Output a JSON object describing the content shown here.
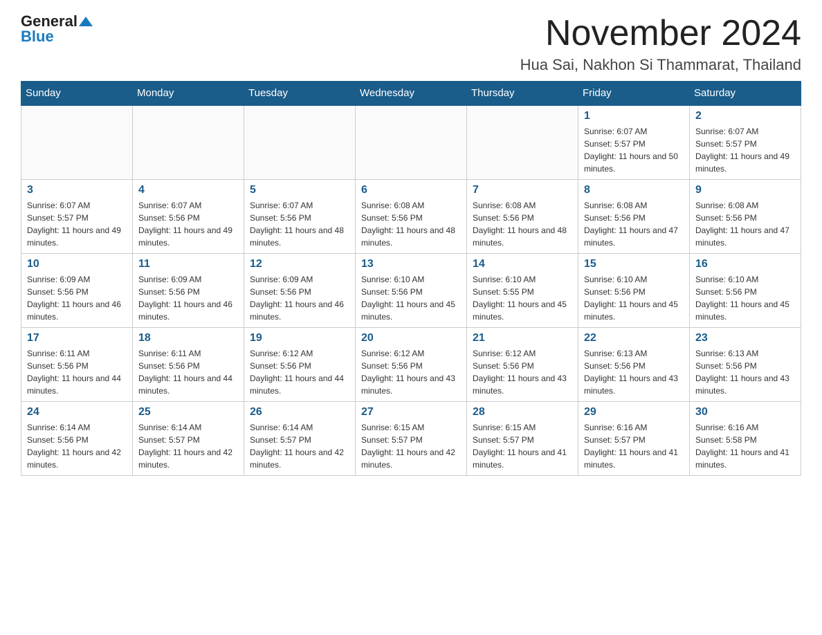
{
  "header": {
    "logo_general": "General",
    "logo_blue": "Blue",
    "month_title": "November 2024",
    "location": "Hua Sai, Nakhon Si Thammarat, Thailand"
  },
  "weekdays": [
    "Sunday",
    "Monday",
    "Tuesday",
    "Wednesday",
    "Thursday",
    "Friday",
    "Saturday"
  ],
  "weeks": [
    [
      {
        "day": "",
        "sunrise": "",
        "sunset": "",
        "daylight": ""
      },
      {
        "day": "",
        "sunrise": "",
        "sunset": "",
        "daylight": ""
      },
      {
        "day": "",
        "sunrise": "",
        "sunset": "",
        "daylight": ""
      },
      {
        "day": "",
        "sunrise": "",
        "sunset": "",
        "daylight": ""
      },
      {
        "day": "",
        "sunrise": "",
        "sunset": "",
        "daylight": ""
      },
      {
        "day": "1",
        "sunrise": "Sunrise: 6:07 AM",
        "sunset": "Sunset: 5:57 PM",
        "daylight": "Daylight: 11 hours and 50 minutes."
      },
      {
        "day": "2",
        "sunrise": "Sunrise: 6:07 AM",
        "sunset": "Sunset: 5:57 PM",
        "daylight": "Daylight: 11 hours and 49 minutes."
      }
    ],
    [
      {
        "day": "3",
        "sunrise": "Sunrise: 6:07 AM",
        "sunset": "Sunset: 5:57 PM",
        "daylight": "Daylight: 11 hours and 49 minutes."
      },
      {
        "day": "4",
        "sunrise": "Sunrise: 6:07 AM",
        "sunset": "Sunset: 5:56 PM",
        "daylight": "Daylight: 11 hours and 49 minutes."
      },
      {
        "day": "5",
        "sunrise": "Sunrise: 6:07 AM",
        "sunset": "Sunset: 5:56 PM",
        "daylight": "Daylight: 11 hours and 48 minutes."
      },
      {
        "day": "6",
        "sunrise": "Sunrise: 6:08 AM",
        "sunset": "Sunset: 5:56 PM",
        "daylight": "Daylight: 11 hours and 48 minutes."
      },
      {
        "day": "7",
        "sunrise": "Sunrise: 6:08 AM",
        "sunset": "Sunset: 5:56 PM",
        "daylight": "Daylight: 11 hours and 48 minutes."
      },
      {
        "day": "8",
        "sunrise": "Sunrise: 6:08 AM",
        "sunset": "Sunset: 5:56 PM",
        "daylight": "Daylight: 11 hours and 47 minutes."
      },
      {
        "day": "9",
        "sunrise": "Sunrise: 6:08 AM",
        "sunset": "Sunset: 5:56 PM",
        "daylight": "Daylight: 11 hours and 47 minutes."
      }
    ],
    [
      {
        "day": "10",
        "sunrise": "Sunrise: 6:09 AM",
        "sunset": "Sunset: 5:56 PM",
        "daylight": "Daylight: 11 hours and 46 minutes."
      },
      {
        "day": "11",
        "sunrise": "Sunrise: 6:09 AM",
        "sunset": "Sunset: 5:56 PM",
        "daylight": "Daylight: 11 hours and 46 minutes."
      },
      {
        "day": "12",
        "sunrise": "Sunrise: 6:09 AM",
        "sunset": "Sunset: 5:56 PM",
        "daylight": "Daylight: 11 hours and 46 minutes."
      },
      {
        "day": "13",
        "sunrise": "Sunrise: 6:10 AM",
        "sunset": "Sunset: 5:56 PM",
        "daylight": "Daylight: 11 hours and 45 minutes."
      },
      {
        "day": "14",
        "sunrise": "Sunrise: 6:10 AM",
        "sunset": "Sunset: 5:55 PM",
        "daylight": "Daylight: 11 hours and 45 minutes."
      },
      {
        "day": "15",
        "sunrise": "Sunrise: 6:10 AM",
        "sunset": "Sunset: 5:56 PM",
        "daylight": "Daylight: 11 hours and 45 minutes."
      },
      {
        "day": "16",
        "sunrise": "Sunrise: 6:10 AM",
        "sunset": "Sunset: 5:56 PM",
        "daylight": "Daylight: 11 hours and 45 minutes."
      }
    ],
    [
      {
        "day": "17",
        "sunrise": "Sunrise: 6:11 AM",
        "sunset": "Sunset: 5:56 PM",
        "daylight": "Daylight: 11 hours and 44 minutes."
      },
      {
        "day": "18",
        "sunrise": "Sunrise: 6:11 AM",
        "sunset": "Sunset: 5:56 PM",
        "daylight": "Daylight: 11 hours and 44 minutes."
      },
      {
        "day": "19",
        "sunrise": "Sunrise: 6:12 AM",
        "sunset": "Sunset: 5:56 PM",
        "daylight": "Daylight: 11 hours and 44 minutes."
      },
      {
        "day": "20",
        "sunrise": "Sunrise: 6:12 AM",
        "sunset": "Sunset: 5:56 PM",
        "daylight": "Daylight: 11 hours and 43 minutes."
      },
      {
        "day": "21",
        "sunrise": "Sunrise: 6:12 AM",
        "sunset": "Sunset: 5:56 PM",
        "daylight": "Daylight: 11 hours and 43 minutes."
      },
      {
        "day": "22",
        "sunrise": "Sunrise: 6:13 AM",
        "sunset": "Sunset: 5:56 PM",
        "daylight": "Daylight: 11 hours and 43 minutes."
      },
      {
        "day": "23",
        "sunrise": "Sunrise: 6:13 AM",
        "sunset": "Sunset: 5:56 PM",
        "daylight": "Daylight: 11 hours and 43 minutes."
      }
    ],
    [
      {
        "day": "24",
        "sunrise": "Sunrise: 6:14 AM",
        "sunset": "Sunset: 5:56 PM",
        "daylight": "Daylight: 11 hours and 42 minutes."
      },
      {
        "day": "25",
        "sunrise": "Sunrise: 6:14 AM",
        "sunset": "Sunset: 5:57 PM",
        "daylight": "Daylight: 11 hours and 42 minutes."
      },
      {
        "day": "26",
        "sunrise": "Sunrise: 6:14 AM",
        "sunset": "Sunset: 5:57 PM",
        "daylight": "Daylight: 11 hours and 42 minutes."
      },
      {
        "day": "27",
        "sunrise": "Sunrise: 6:15 AM",
        "sunset": "Sunset: 5:57 PM",
        "daylight": "Daylight: 11 hours and 42 minutes."
      },
      {
        "day": "28",
        "sunrise": "Sunrise: 6:15 AM",
        "sunset": "Sunset: 5:57 PM",
        "daylight": "Daylight: 11 hours and 41 minutes."
      },
      {
        "day": "29",
        "sunrise": "Sunrise: 6:16 AM",
        "sunset": "Sunset: 5:57 PM",
        "daylight": "Daylight: 11 hours and 41 minutes."
      },
      {
        "day": "30",
        "sunrise": "Sunrise: 6:16 AM",
        "sunset": "Sunset: 5:58 PM",
        "daylight": "Daylight: 11 hours and 41 minutes."
      }
    ]
  ]
}
